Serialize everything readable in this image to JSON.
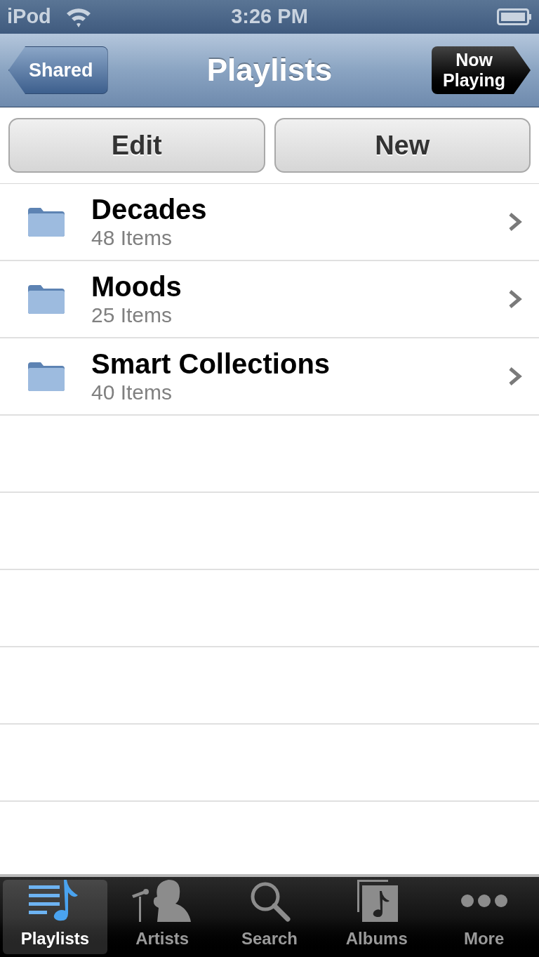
{
  "status_bar": {
    "carrier": "iPod",
    "time": "3:26 PM"
  },
  "nav_bar": {
    "back": "Shared",
    "title": "Playlists",
    "now_playing": [
      "Now",
      "Playing"
    ]
  },
  "toolbar": {
    "buttons": [
      "Edit",
      "New"
    ]
  },
  "playlists": [
    {
      "name": "Decades",
      "count": "48 Items"
    },
    {
      "name": "Moods",
      "count": "25 Items"
    },
    {
      "name": "Smart Collections",
      "count": "40 Items"
    }
  ],
  "tab_bar": [
    {
      "kind": "playlists",
      "label": "Playlists",
      "selected": true
    },
    {
      "kind": "artists",
      "label": "Artists",
      "selected": false
    },
    {
      "kind": "search",
      "label": "Search",
      "selected": false
    },
    {
      "kind": "albums",
      "label": "Albums",
      "selected": false
    },
    {
      "kind": "more",
      "label": "More",
      "selected": false
    }
  ]
}
